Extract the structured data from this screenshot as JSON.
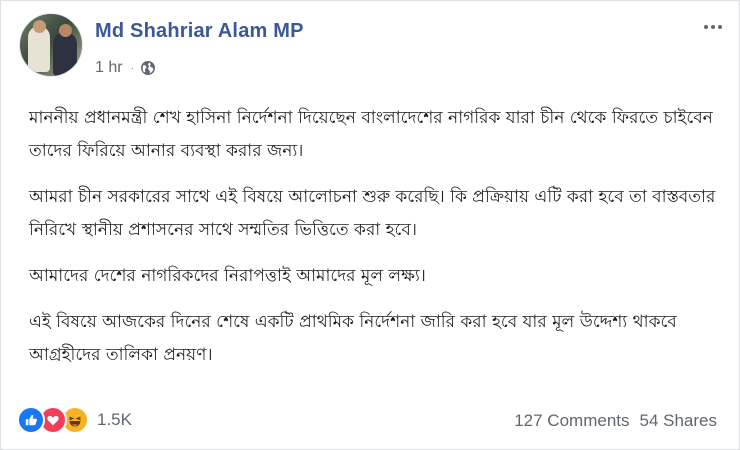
{
  "post": {
    "author_name": "Md Shahriar Alam MP",
    "timestamp": "1 hr",
    "separator": "·",
    "privacy_icon": "globe-icon",
    "menu_icon": "more-options-icon",
    "paragraphs": [
      "মাননীয় প্রধানমন্ত্রী শেখ হাসিনা নির্দেশনা দিয়েছেন বাংলাদেশের নাগরিক যারা চীন থেকে ফিরতে চাইবেন তাদের ফিরিয়ে আনার ব্যবস্থা করার জন্য।",
      "আমরা চীন সরকারের সাথে এই বিষয়ে আলোচনা শুরু করেছি। কি প্রক্রিয়ায় এটি করা হবে তা বাস্তবতার নিরিখে স্থানীয় প্রশাসনের সাথে সম্মতির ভিত্তিতে করা হবে।",
      "আমাদের দেশের নাগরিকদের নিরাপত্তাই আমাদের মূল লক্ষ্য।",
      "এই বিষয়ে আজকের দিনের শেষে একটি প্রাথমিক নির্দেশনা জারি করা হবে যার মূল উদ্দেশ্য থাকবে আগ্রহীদের তালিকা প্রনয়ণ।"
    ]
  },
  "footer": {
    "reaction_icons": [
      "like-icon",
      "love-icon",
      "haha-icon"
    ],
    "reaction_count": "1.5K",
    "comments": "127 Comments",
    "shares": "54 Shares"
  },
  "colors": {
    "author": "#3b5998",
    "meta": "#616770",
    "like": "#1877f2",
    "love": "#f33e58",
    "haha": "#f7b125"
  }
}
